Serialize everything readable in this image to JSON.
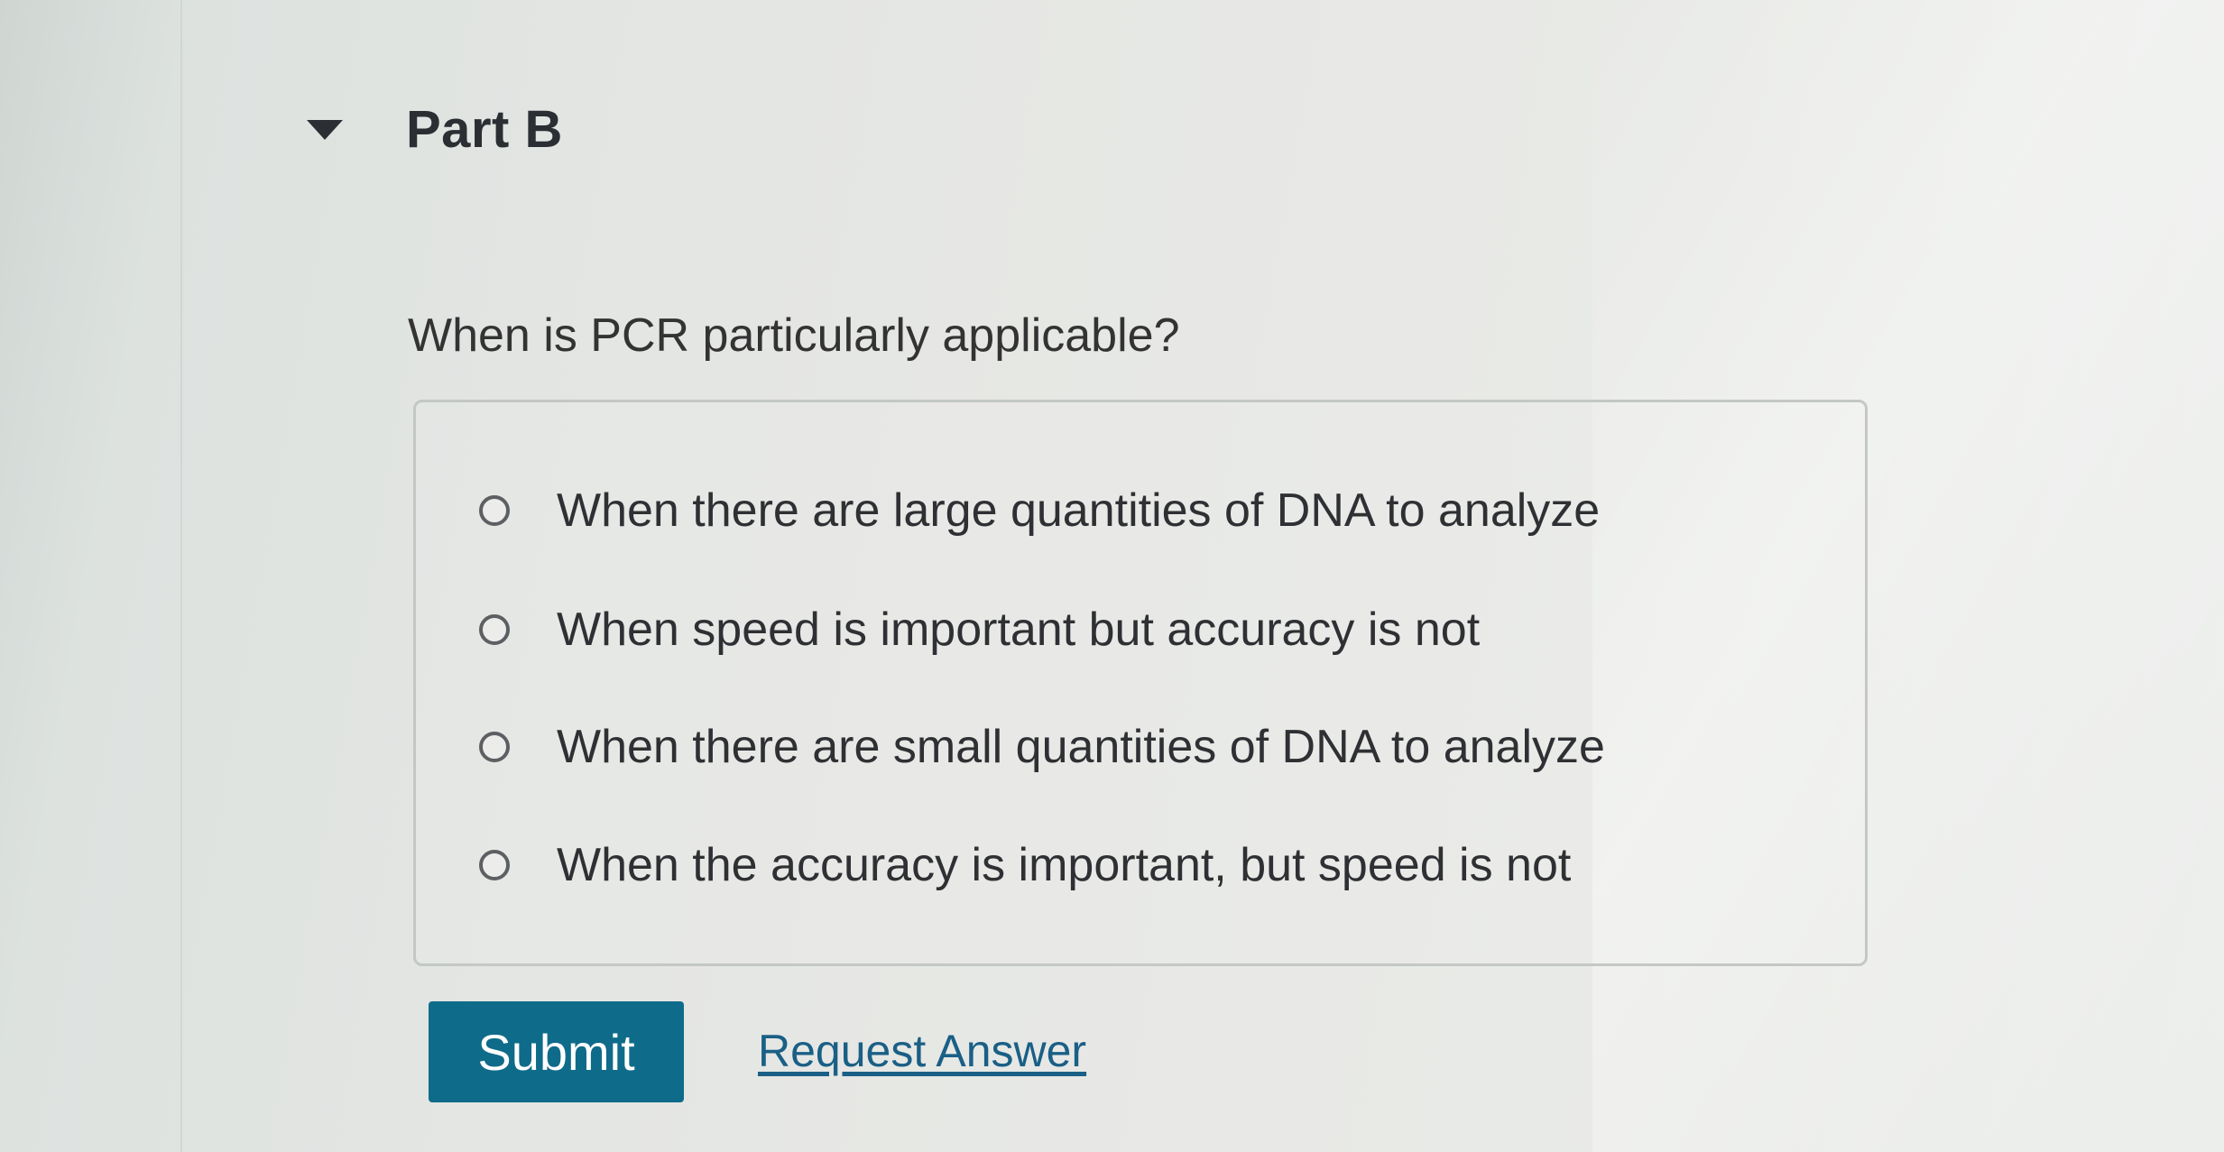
{
  "part": {
    "title": "Part B"
  },
  "question": {
    "text": "When is PCR particularly applicable?"
  },
  "options": [
    {
      "label": "When there are large quantities of DNA to analyze",
      "selected": false
    },
    {
      "label": "When speed is important but accuracy is not",
      "selected": false
    },
    {
      "label": "When there are small quantities of DNA to analyze",
      "selected": false
    },
    {
      "label": "When the accuracy is important, but speed is not",
      "selected": false
    }
  ],
  "actions": {
    "submit_label": "Submit",
    "request_answer_label": "Request Answer"
  },
  "colors": {
    "submit_bg": "#0f6b8a",
    "link": "#1a5f86"
  },
  "icons": {
    "collapse": "caret-down-icon",
    "option": "radio-unchecked-icon"
  }
}
